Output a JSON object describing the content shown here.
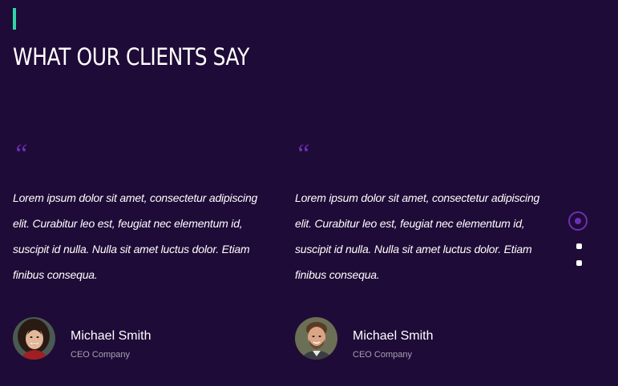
{
  "section": {
    "title": "WHAT OUR CLIENTS SAY",
    "accent_color": "#2fd6a8",
    "background_color": "#1f0b37",
    "quote_color": "#6d2fb3"
  },
  "testimonials": [
    {
      "quote_icon": "“",
      "text": "Lorem ipsum dolor sit amet, consectetur adipiscing elit. Curabitur leo est, feugiat nec elementum id, suscipit id nulla. Nulla sit amet luctus dolor. Etiam finibus consequa.",
      "author_name": "Michael Smith",
      "author_role": "CEO Company",
      "avatar": "woman-portrait-avatar"
    },
    {
      "quote_icon": "“",
      "text": "Lorem ipsum dolor sit amet, consectetur adipiscing elit. Curabitur leo est, feugiat nec elementum id, suscipit id nulla. Nulla sit amet luctus dolor. Etiam finibus consequa.",
      "author_name": "Michael Smith",
      "author_role": "CEO Company",
      "avatar": "man-portrait-avatar"
    }
  ],
  "pagination": {
    "pages": 3,
    "active_index": 0
  }
}
